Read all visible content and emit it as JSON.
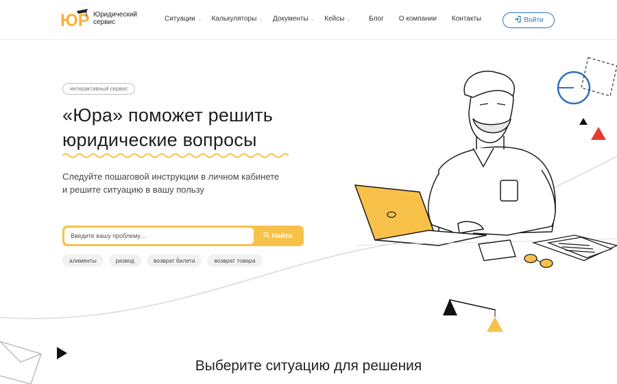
{
  "header": {
    "logo_mark": "ЮР",
    "logo_line1": "Юридический",
    "logo_line2": "сервис",
    "nav": [
      {
        "label": "Ситуации",
        "dropdown": true
      },
      {
        "label": "Калькуляторы",
        "dropdown": true
      },
      {
        "label": "Документы",
        "dropdown": true
      },
      {
        "label": "Кейсы",
        "dropdown": true
      },
      {
        "label": "Блог",
        "dropdown": false
      },
      {
        "label": "О компании",
        "dropdown": false
      },
      {
        "label": "Контакты",
        "dropdown": false
      }
    ],
    "login_label": "Войти"
  },
  "hero": {
    "badge": "интерактивный сервис",
    "title_line1": "«Юра» поможет решить",
    "title_line2": "юридические вопросы",
    "subtitle_line1": "Следуйте пошаговой инструкции в личном кабинете",
    "subtitle_line2": "и решите ситуацию в вашу пользу",
    "search_placeholder": "Введите вашу проблему…",
    "search_button": "Найти",
    "tags": [
      "алименты",
      "развод",
      "возврат билета",
      "возврат товара"
    ]
  },
  "section_title": "Выберите ситуацию для решения",
  "colors": {
    "accent": "#f8c14a",
    "link": "#2f6fbf",
    "red": "#e63b2e"
  }
}
